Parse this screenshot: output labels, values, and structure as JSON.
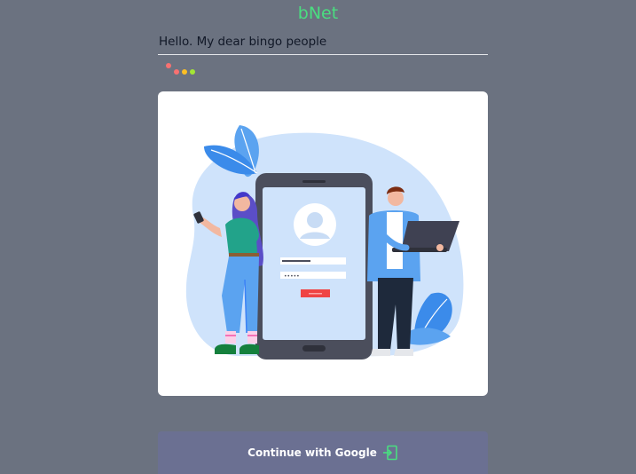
{
  "app": {
    "title": "bNet"
  },
  "message": {
    "text": "Hello. My dear bingo people"
  },
  "typing_indicator": {
    "dot_colors": [
      "#f87171",
      "#f87171",
      "#fbbf24",
      "#a3e635"
    ]
  },
  "illustration": {
    "subject": "login-illustration",
    "password_mask": "•••••"
  },
  "auth": {
    "google_label": "Continue with Google",
    "icon": "sign-in-icon"
  },
  "colors": {
    "background": "#6b7280",
    "title": "#4ade80",
    "button": "#6b7092",
    "icon": "#4ade80"
  }
}
